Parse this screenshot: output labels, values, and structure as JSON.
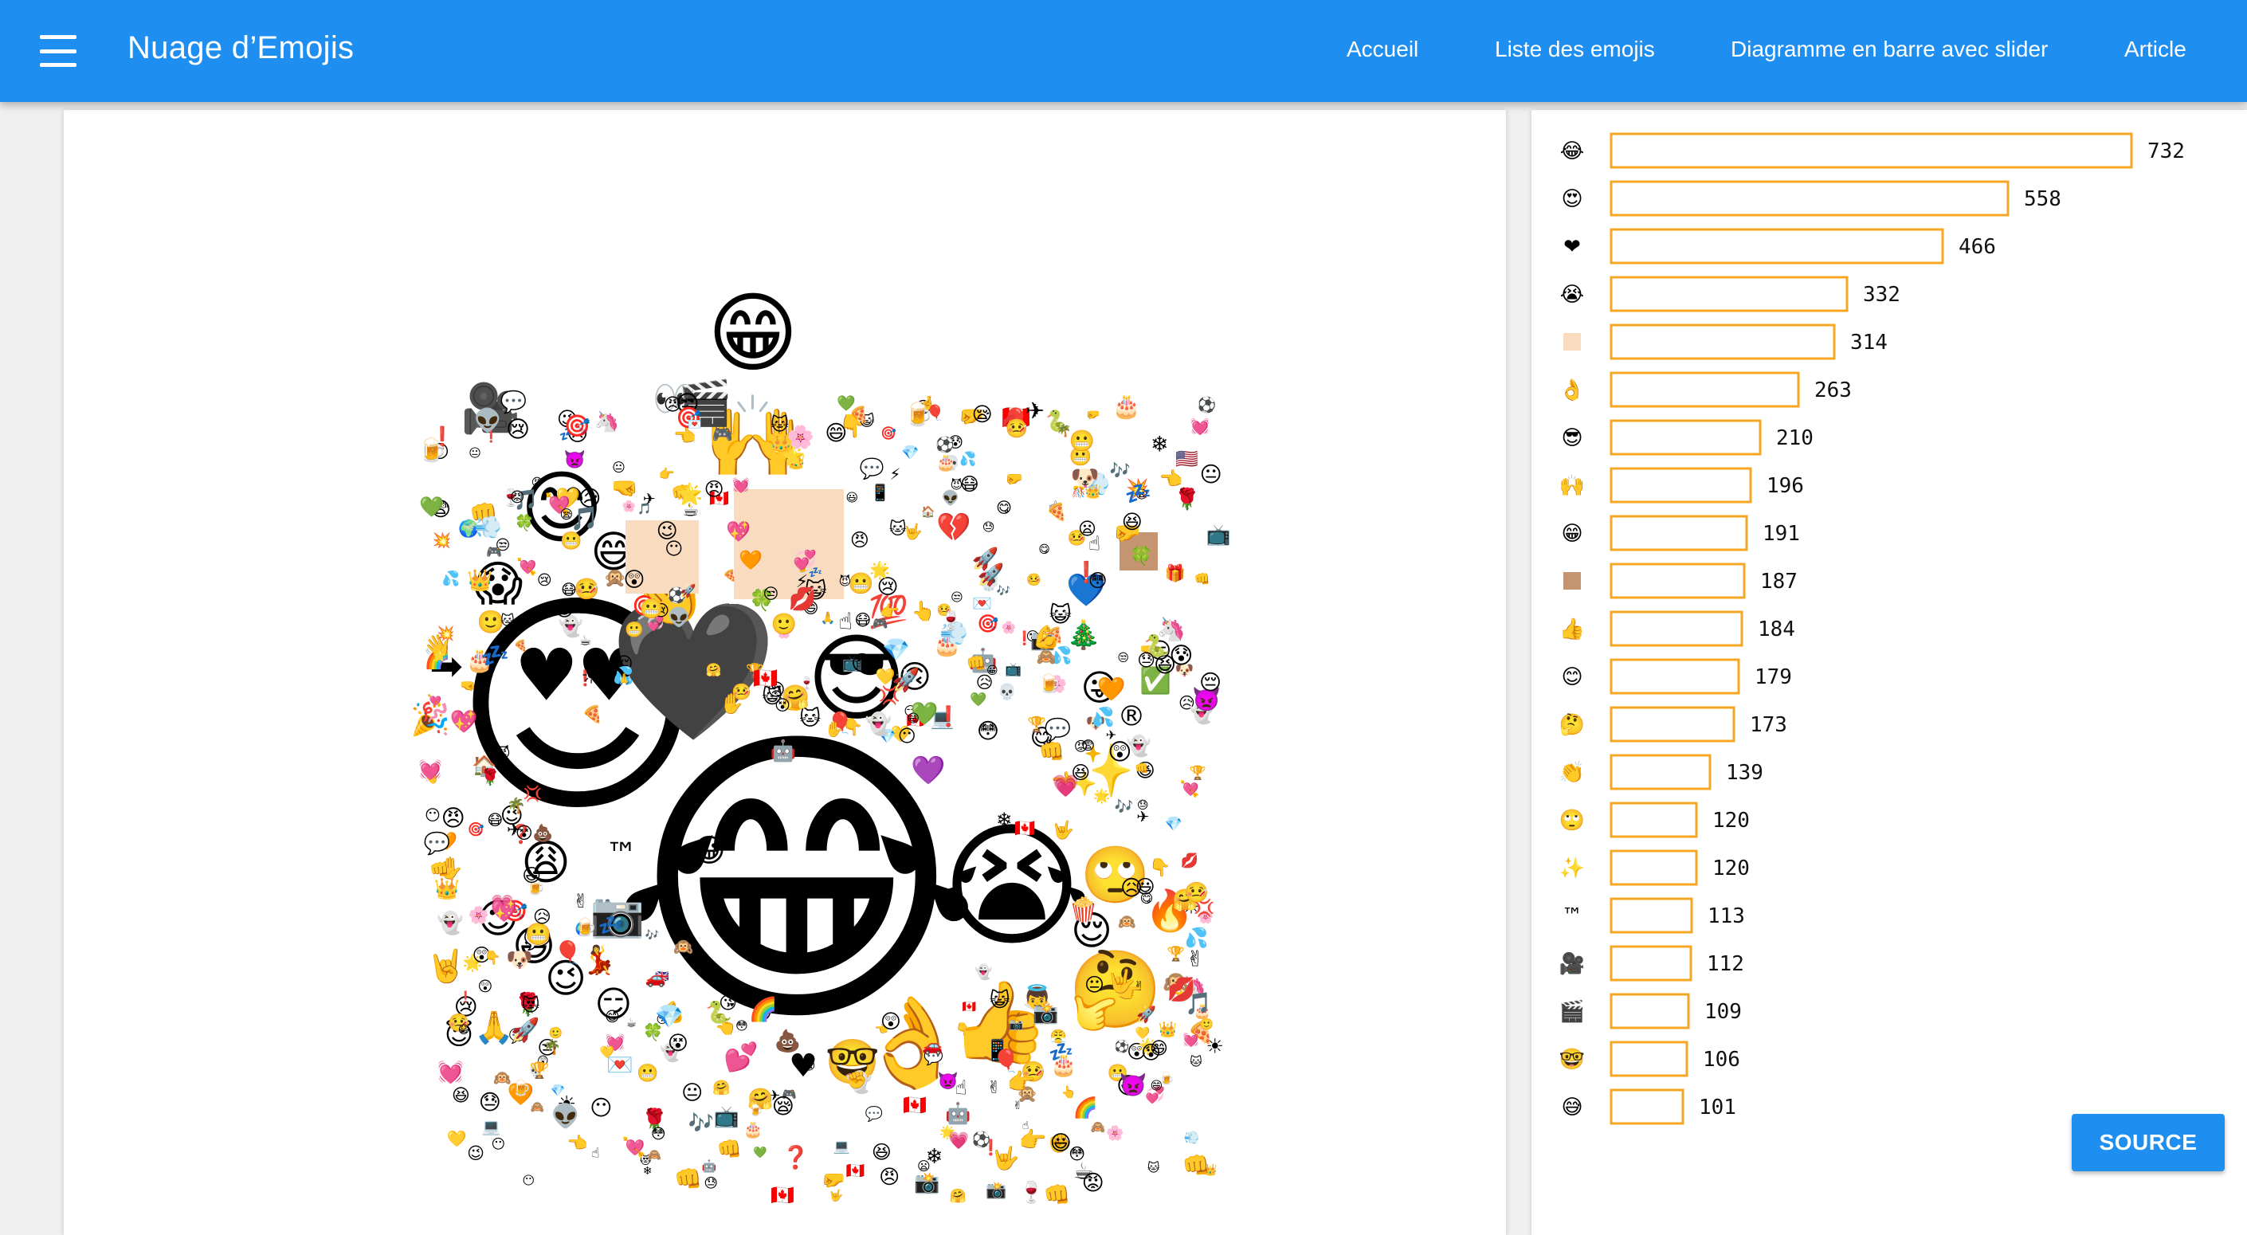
{
  "appbar": {
    "title": "Nuage d’Emojis",
    "menu_icon": "hamburger-menu-icon",
    "nav": [
      "Accueil",
      "Liste des emojis",
      "Diagramme en barre avec slider",
      "Article"
    ]
  },
  "colors": {
    "primary": "#1e8ef0",
    "bar_stroke": "#f5a623",
    "tan_light": "#f9dcc0",
    "tan_dark": "#c49570"
  },
  "cloud": {
    "large_emojis": [
      "😂",
      "😍",
      "🖤",
      "😎",
      "😭",
      "😊",
      "😁",
      "👌",
      "👍",
      "🙌",
      "🤔",
      "😱",
      "😅",
      "🙄",
      "👏",
      "😩",
      "😆",
      "😌",
      "😉",
      "🤓",
      "👀",
      "🎥",
      "🎬",
      "™",
      "✨",
      "®",
      "➡",
      "☺",
      "📷",
      "🔥",
      "💯",
      "💙",
      "✅",
      "⭐",
      "💔",
      "🎄",
      "🤘",
      "♥",
      "🙏",
      "💕",
      "😜",
      "😀",
      "🙃",
      "😏",
      "🎉",
      "💃",
      "👼",
      "😇",
      "💜",
      "🍿"
    ],
    "small_emojis": [
      "😀",
      "😃",
      "😄",
      "😆",
      "😉",
      "😋",
      "😘",
      "🙂",
      "🤗",
      "😐",
      "😶",
      "😏",
      "😒",
      "😬",
      "😔",
      "😪",
      "😴",
      "😷",
      "🤒",
      "😵",
      "😲",
      "😳",
      "😦",
      "😨",
      "😰",
      "😢",
      "😥",
      "😓",
      "😤",
      "😡",
      "😠",
      "😈",
      "👿",
      "💀",
      "👻",
      "👽",
      "🤖",
      "💩",
      "😺",
      "😸",
      "😻",
      "🙈",
      "🙉",
      "🙊",
      "💋",
      "💌",
      "💘",
      "💖",
      "💗",
      "💓",
      "💞",
      "💚",
      "💛",
      "🧡",
      "💤",
      "💢",
      "💥",
      "💦",
      "💨",
      "👋",
      "✋",
      "🤞",
      "✌",
      "🤟",
      "👈",
      "👉",
      "👆",
      "👇",
      "☝",
      "✊",
      "👊",
      "🤛",
      "🤜",
      "🙏",
      "💪",
      "🎂",
      "🎁",
      "🎈",
      "🎊",
      "🌹",
      "🌸",
      "🌟",
      "⚡",
      "❄",
      "☀",
      "🌈",
      "🍕",
      "🍺",
      "🍷",
      "☕",
      "🏆",
      "⚽",
      "🎵",
      "🎶",
      "📸",
      "📺",
      "💻",
      "📱",
      "✈",
      "🚀",
      "🚗",
      "🏠",
      "🌍",
      "🇺🇸",
      "🇫🇷",
      "🇬🇧",
      "🇨🇦",
      "❗",
      "❓",
      "💬",
      "👑",
      "💎",
      "🎯",
      "🎮",
      "🐶",
      "🐱",
      "🦄",
      "🐍",
      "🌴",
      "🍀"
    ]
  },
  "chart_data": {
    "type": "bar",
    "orientation": "horizontal",
    "categories": [
      "😂",
      "😍",
      "❤",
      "😭",
      "tan-square-light",
      "👌",
      "😎",
      "🙌",
      "😁",
      "tan-square-dark",
      "👍",
      "😊",
      "🤔",
      "👏",
      "🙄",
      "✨",
      "™",
      "🎥",
      "🎬",
      "🤓",
      "😅"
    ],
    "values": [
      732,
      558,
      466,
      332,
      314,
      263,
      210,
      196,
      191,
      187,
      184,
      179,
      173,
      139,
      120,
      120,
      113,
      112,
      109,
      106,
      101
    ],
    "xlim": [
      0,
      732
    ],
    "grid": false,
    "legend": "none"
  },
  "source_button": {
    "label": "SOURCE"
  }
}
